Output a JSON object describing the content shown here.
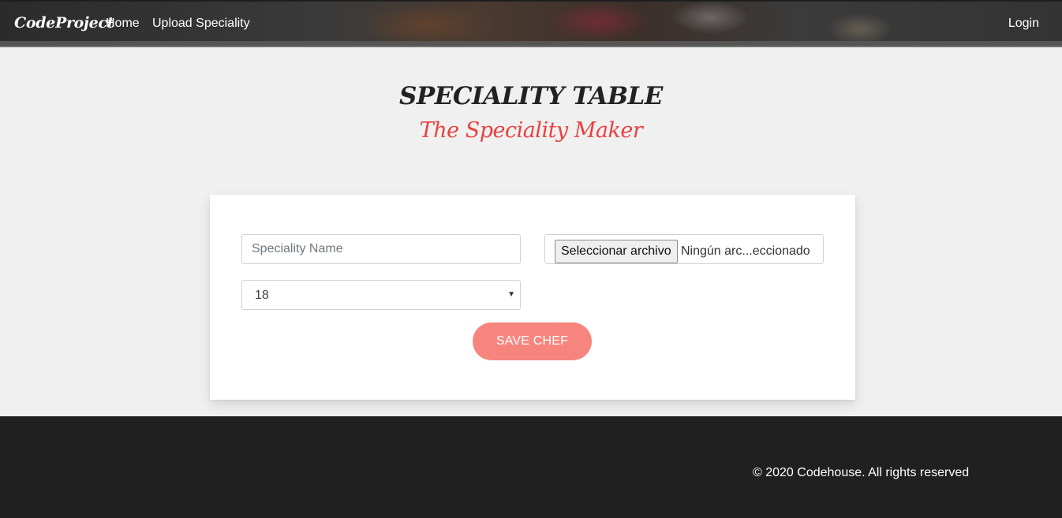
{
  "nav": {
    "brand": "CodeProject",
    "links": [
      {
        "label": "Home"
      },
      {
        "label": "Upload Speciality"
      }
    ],
    "login_label": "Login"
  },
  "header": {
    "title": "SPECIALITY TABLE",
    "subtitle": "The Speciality Maker"
  },
  "form": {
    "name_placeholder": "Speciality Name",
    "name_value": "",
    "file_button_label": "Seleccionar archivo",
    "file_status": "Ningún arc...eccionado",
    "select_value": "18",
    "save_label": "SAVE CHEF"
  },
  "footer": {
    "copyright": "© 2020 Codehouse. All rights reserved"
  },
  "colors": {
    "accent": "#e8413f",
    "button": "#f7857e",
    "footer_bg": "#202020",
    "page_bg": "#f0f0f0"
  }
}
